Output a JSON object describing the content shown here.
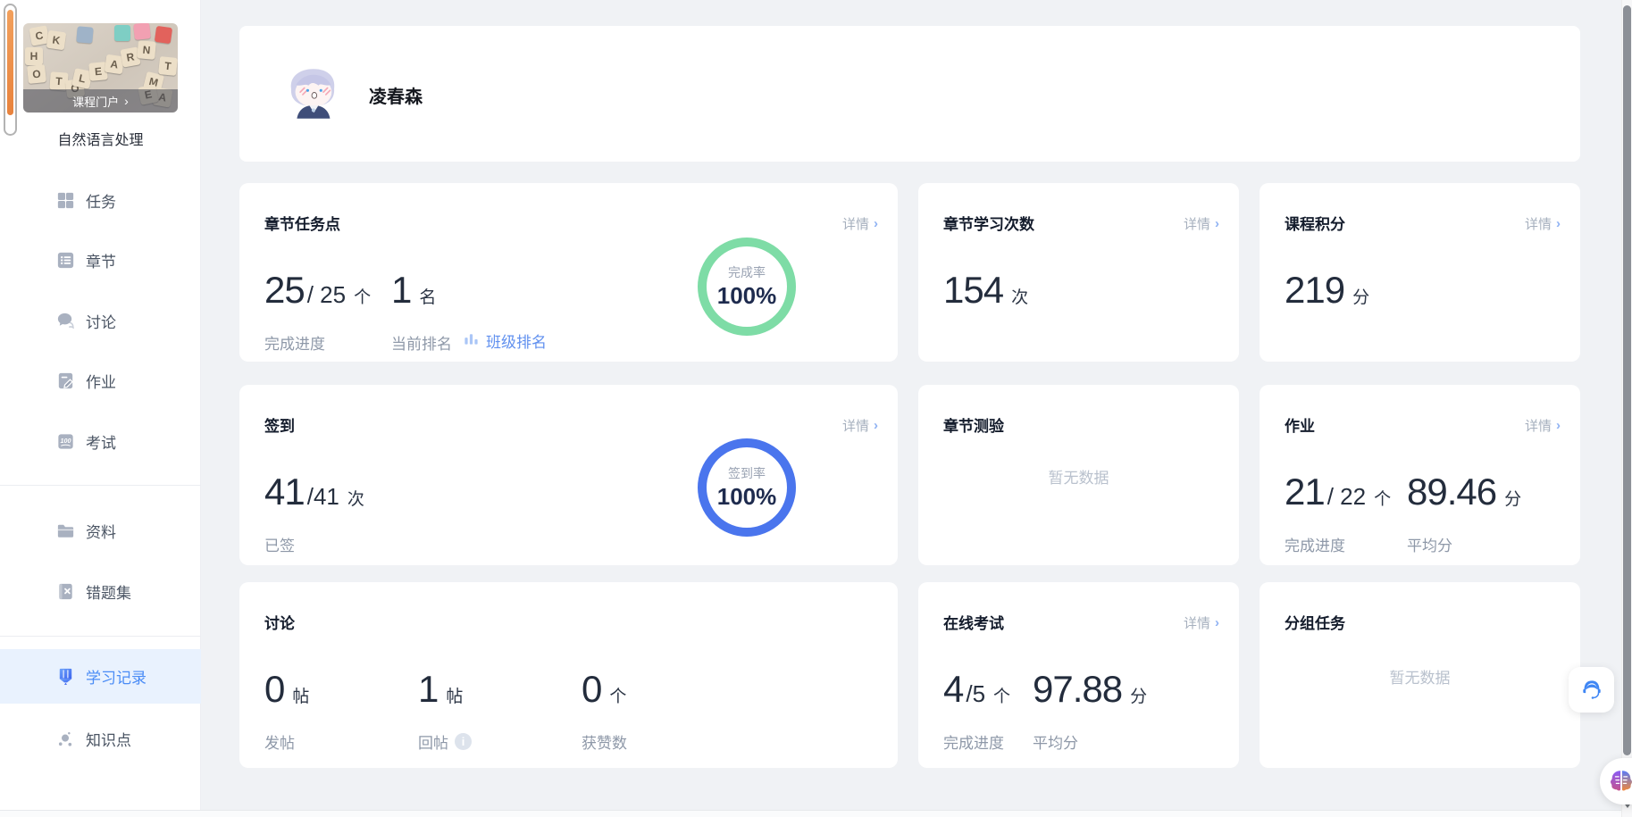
{
  "ui": {
    "chevron": "›"
  },
  "colors": {
    "accent_blue": "#4a8cf6",
    "link_blue": "#6090ef",
    "ring_green": "#7edca6",
    "ring_blue": "#4a75ed",
    "active_item_bg": "#e9f2fe",
    "service_icon_blue": "#3f86f4"
  },
  "sidebar": {
    "course_portal": "课程门户",
    "course_title": "自然语言处理",
    "thumb_letters": [
      "C",
      "K",
      "H",
      "O",
      "T",
      "O",
      "L",
      "E",
      "A",
      "R",
      "N",
      "M",
      "A",
      "T",
      "E"
    ],
    "menu": [
      {
        "label": "任务"
      },
      {
        "label": "章节"
      },
      {
        "label": "讨论"
      },
      {
        "label": "作业"
      },
      {
        "label": "考试"
      },
      {
        "label": "资料"
      },
      {
        "label": "错题集"
      },
      {
        "label": "学习记录"
      },
      {
        "label": "知识点"
      }
    ]
  },
  "header": {
    "user_name": "凌春森"
  },
  "cards": {
    "chapter_tasks": {
      "title": "章节任务点",
      "detail": "详情",
      "done": "25",
      "total": "/ 25",
      "unit": "个",
      "rank": "1",
      "rank_unit": "名",
      "progress_label": "完成进度",
      "rank_label": "当前排名",
      "class_rank": "班级排名",
      "ring_label": "完成率",
      "ring_value": "100%"
    },
    "study_count": {
      "title": "章节学习次数",
      "detail": "详情",
      "value": "154",
      "unit": "次"
    },
    "course_points": {
      "title": "课程积分",
      "detail": "详情",
      "value": "219",
      "unit": "分"
    },
    "sign_in": {
      "title": "签到",
      "detail": "详情",
      "done": "41",
      "total": "/41",
      "unit": "次",
      "label": "已签",
      "ring_label": "签到率",
      "ring_value": "100%"
    },
    "chapter_quiz": {
      "title": "章节测验",
      "empty": "暂无数据"
    },
    "homework": {
      "title": "作业",
      "detail": "详情",
      "done": "21",
      "total": "/ 22",
      "unit": "个",
      "score": "89.46",
      "score_unit": "分",
      "progress_label": "完成进度",
      "avg_label": "平均分"
    },
    "discussion": {
      "title": "讨论",
      "posts": "0",
      "posts_unit": "帖",
      "posts_label": "发帖",
      "replies": "1",
      "replies_unit": "帖",
      "replies_label": "回帖",
      "likes": "0",
      "likes_unit": "个",
      "likes_label": "获赞数"
    },
    "online_exam": {
      "title": "在线考试",
      "detail": "详情",
      "done": "4",
      "total": "/5",
      "unit": "个",
      "score": "97.88",
      "score_unit": "分",
      "progress_label": "完成进度",
      "avg_label": "平均分"
    },
    "group_tasks": {
      "title": "分组任务",
      "empty": "暂无数据"
    }
  }
}
